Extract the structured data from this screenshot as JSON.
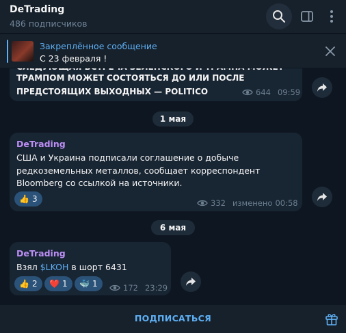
{
  "header": {
    "title": "DeTrading",
    "subscribers": "486 подписчиков"
  },
  "pinned": {
    "title": "Закреплённое сообщение",
    "text": "С 23 февраля !"
  },
  "messages": [
    {
      "cut_text": "СЛЕДУЮЩАЯ ВСТРЕЧА ЗЕЛЕНСКОГО И ТРАМПА МОЖЕТ",
      "text": "ТРАМПОМ МОЖЕТ СОСТОЯТЬСЯ ДО ИЛИ ПОСЛЕ ПРЕДСТОЯЩИХ ВЫХОДНЫХ — POLITICO",
      "views": "644",
      "time": "09:59"
    },
    {
      "date": "1 мая",
      "author": "DeTrading",
      "text": "США и Украина подписали соглашение о добыче редкоземельных металлов, сообщает корреспондент Bloomberg со ссылкой на источники.",
      "reactions": [
        {
          "emoji": "👍",
          "count": "3"
        }
      ],
      "views": "332",
      "edited": "изменено",
      "time": "00:58"
    },
    {
      "date": "6 мая",
      "author": "DeTrading",
      "text_before": "Взял ",
      "cashtag": "$LKOH",
      "text_after": " в шорт 6431",
      "reactions": [
        {
          "emoji": "👍",
          "count": "2"
        },
        {
          "emoji": "❤️",
          "count": "1"
        },
        {
          "emoji": "🐳",
          "count": "1"
        }
      ],
      "views": "172",
      "time": "23:29"
    }
  ],
  "footer": {
    "subscribe_label": "ПОДПИСАТЬСЯ"
  },
  "colors": {
    "background": "#0e1621",
    "panel": "#17212b",
    "bubble": "#182533",
    "accent": "#5eaff4",
    "author": "#bd8ff5",
    "reaction": "#2b5278"
  },
  "icons": [
    "search-icon",
    "sidebar-panel-icon",
    "more-vert-icon",
    "close-icon",
    "eye-icon",
    "share-icon",
    "gift-icon"
  ]
}
